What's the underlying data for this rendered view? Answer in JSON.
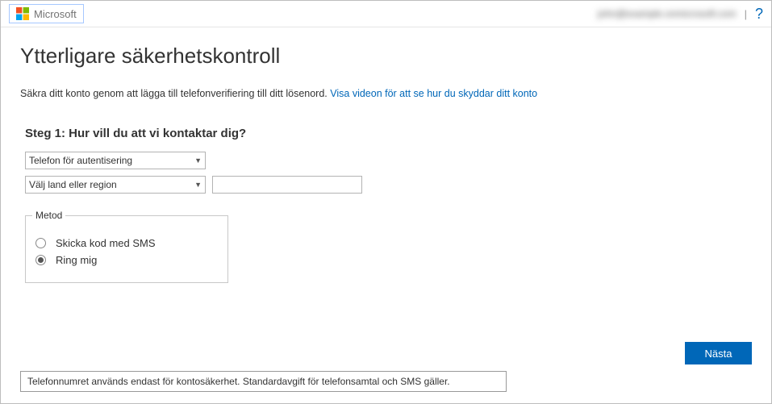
{
  "topbar": {
    "brand": "Microsoft",
    "email": "john@example.onmicrosoft.com",
    "help": "?"
  },
  "page": {
    "title": "Ytterligare säkerhetskontroll",
    "desc_pre": "Säkra ditt konto genom att lägga till telefonverifiering till ditt lösenord. ",
    "desc_link": "Visa videon för att se hur du skyddar ditt konto",
    "step_label": "Steg 1: Hur vill du att vi kontaktar dig?",
    "select_method": "Telefon för autentisering",
    "select_country": "Välj land eller region",
    "phone_value": "",
    "fieldset_legend": "Metod",
    "opt_sms": "Skicka kod med SMS",
    "opt_call": "Ring mig",
    "selected": "call",
    "next": "Nästa",
    "note": "Telefonnumret används endast för kontosäkerhet. Standardavgift för telefonsamtal och SMS gäller."
  }
}
